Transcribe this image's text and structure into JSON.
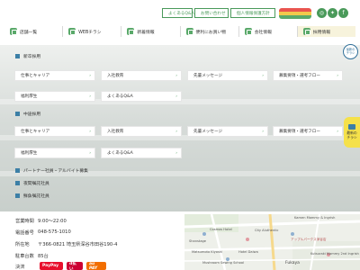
{
  "header": {
    "utility_links": [
      "よくあるQ&A",
      "お問い合わせ",
      "個人情報保護方針"
    ],
    "social": [
      "instagram-icon",
      "twitter-icon",
      "facebook-icon"
    ],
    "nav": [
      {
        "label": "店舗一覧",
        "icon": "shop-icon"
      },
      {
        "label": "WEBチラシ",
        "icon": "flyer-icon"
      },
      {
        "label": "新着情報",
        "icon": "news-icon"
      },
      {
        "label": "便利にお買い物",
        "icon": "cart-icon"
      },
      {
        "label": "会社情報",
        "icon": "building-icon"
      },
      {
        "label": "採用情報",
        "icon": "recruit-icon"
      }
    ]
  },
  "menu": {
    "new_grad": {
      "heading": "新卒採用",
      "items": [
        "仕事とキャリア",
        "入社教育",
        "先輩メッセージ",
        "募集要項・選考フロー",
        "福利厚生",
        "よくあるQ&A"
      ]
    },
    "mid_career": {
      "heading": "中途採用",
      "items": [
        "仕事とキャリア",
        "入社教育",
        "先輩メッセージ",
        "募集要項・選考フロー",
        "福利厚生",
        "よくあるQ&A"
      ]
    },
    "links": [
      "パートナー社員・アルバイト募集",
      "夜間嘱託社員",
      "鮮魚嘱託社員"
    ]
  },
  "side_tab": {
    "line1": "最新の",
    "line2": "チラシ"
  },
  "float_button": {
    "line1": "最新の",
    "line2": "チラシ"
  },
  "store": {
    "rows": [
      {
        "label": "営業時間",
        "value": "9:00〜22:00"
      },
      {
        "label": "電話番号",
        "value": "048-575-1010"
      },
      {
        "label": "所在地",
        "value": "〒366-0821 埼玉県深谷市田谷190-4"
      },
      {
        "label": "駐車台数",
        "value": "85台"
      },
      {
        "label": "決済",
        "value": ""
      }
    ],
    "payments": [
      "PayPay",
      "d払い",
      "au PAY"
    ]
  },
  "map": {
    "labels": [
      "Kamen Mammy & Ingrish",
      "Cosmos Hotel",
      "City Aluthentic",
      "Shanstage",
      "アップルパークス深谷店",
      "Matsumoto Kiyoshi",
      "Hotel Daiwa",
      "Mushroom Sewing School",
      "Fukaya",
      "Kutsuraki Mammy 2nd Ingrish"
    ]
  },
  "colors": {
    "brand_green": "#4a9a5a",
    "section_blue": "#3c7fa6",
    "side_tab_yellow": "#f5e14a"
  }
}
